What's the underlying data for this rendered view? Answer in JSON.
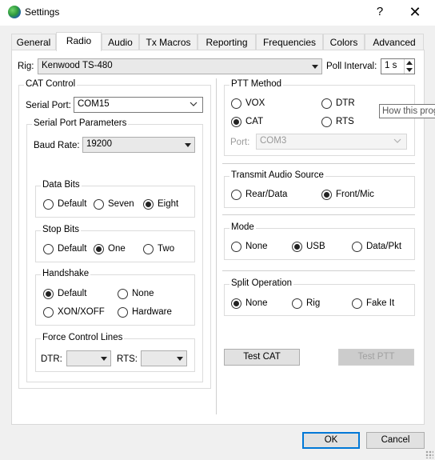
{
  "window": {
    "title": "Settings",
    "help_glyph": "?",
    "close_glyph": "✕"
  },
  "tabs": [
    "General",
    "Radio",
    "Audio",
    "Tx Macros",
    "Reporting",
    "Frequencies",
    "Colors",
    "Advanced"
  ],
  "active_tab": "Radio",
  "rig": {
    "label": "Rig:",
    "value": "Kenwood TS-480"
  },
  "poll_interval": {
    "label": "Poll Interval:",
    "value": "1 s"
  },
  "cat_control": {
    "title": "CAT Control",
    "serial_port_label": "Serial Port:",
    "serial_port_value": "COM15",
    "params_title": "Serial Port Parameters",
    "baud_label": "Baud Rate:",
    "baud_value": "19200",
    "data_bits": {
      "title": "Data Bits",
      "options": [
        "Default",
        "Seven",
        "Eight"
      ],
      "selected": "Eight"
    },
    "stop_bits": {
      "title": "Stop Bits",
      "options": [
        "Default",
        "One",
        "Two"
      ],
      "selected": "One"
    },
    "handshake": {
      "title": "Handshake",
      "options": [
        "Default",
        "None",
        "XON/XOFF",
        "Hardware"
      ],
      "selected": "Default"
    },
    "force_control": {
      "title": "Force Control Lines",
      "dtr_label": "DTR:",
      "rts_label": "RTS:",
      "dtr_value": "",
      "rts_value": ""
    }
  },
  "ptt_method": {
    "title": "PTT Method",
    "options": [
      "VOX",
      "DTR",
      "CAT",
      "RTS"
    ],
    "selected": "CAT",
    "port_label": "Port:",
    "port_value": "COM3"
  },
  "tooltip": "How this prog",
  "transmit_audio_source": {
    "title": "Transmit Audio Source",
    "options": [
      "Rear/Data",
      "Front/Mic"
    ],
    "selected": "Front/Mic"
  },
  "mode": {
    "title": "Mode",
    "options": [
      "None",
      "USB",
      "Data/Pkt"
    ],
    "selected": "USB"
  },
  "split_operation": {
    "title": "Split Operation",
    "options": [
      "None",
      "Rig",
      "Fake It"
    ],
    "selected": "None"
  },
  "buttons": {
    "test_cat": "Test CAT",
    "test_ptt": "Test PTT",
    "ok": "OK",
    "cancel": "Cancel"
  },
  "colors": {
    "accent": "#0078d7",
    "panel": "#ffffff",
    "chrome": "#f0f0f0"
  }
}
